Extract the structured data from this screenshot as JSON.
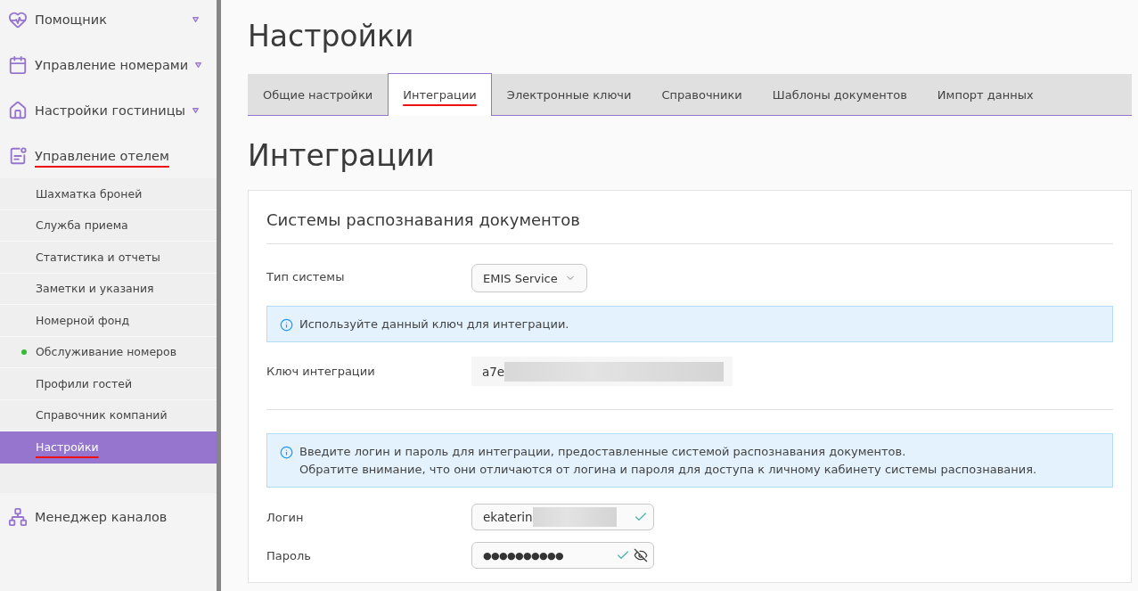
{
  "sidebar": {
    "items": [
      {
        "label": "Помощник",
        "caret": true,
        "marked": false
      },
      {
        "label": "Управление номерами",
        "caret": true,
        "marked": false
      },
      {
        "label": "Настройки гостиницы",
        "caret": true,
        "marked": false
      },
      {
        "label": "Управление отелем",
        "caret": false,
        "marked": true,
        "children": [
          {
            "label": "Шахматка броней",
            "selected": false,
            "marked": false,
            "dot": false
          },
          {
            "label": "Служба приема",
            "selected": false,
            "marked": false,
            "dot": false
          },
          {
            "label": "Статистика и отчеты",
            "selected": false,
            "marked": false,
            "dot": false
          },
          {
            "label": "Заметки и указания",
            "selected": false,
            "marked": false,
            "dot": false
          },
          {
            "label": "Номерной фонд",
            "selected": false,
            "marked": false,
            "dot": false
          },
          {
            "label": "Обслуживание номеров",
            "selected": false,
            "marked": false,
            "dot": true
          },
          {
            "label": "Профили гостей",
            "selected": false,
            "marked": false,
            "dot": false
          },
          {
            "label": "Справочник компаний",
            "selected": false,
            "marked": false,
            "dot": false
          },
          {
            "label": "Настройки",
            "selected": true,
            "marked": true,
            "dot": false
          }
        ]
      },
      {
        "label": "Менеджер каналов",
        "caret": false,
        "marked": false
      }
    ]
  },
  "page_title": "Настройки",
  "tabs": [
    {
      "label": "Общие настройки",
      "selected": false,
      "marked": false
    },
    {
      "label": "Интеграции",
      "selected": true,
      "marked": true
    },
    {
      "label": "Электронные ключи",
      "selected": false,
      "marked": false
    },
    {
      "label": "Справочники",
      "selected": false,
      "marked": false
    },
    {
      "label": "Шаблоны документов",
      "selected": false,
      "marked": false
    },
    {
      "label": "Импорт данных",
      "selected": false,
      "marked": false
    }
  ],
  "section_title": "Интеграции",
  "card": {
    "title": "Системы распознавания документов",
    "system_type": {
      "label": "Тип системы",
      "value": "EMIS Service"
    },
    "key_notice": "Используйте данный ключ для интеграции.",
    "integration_key": {
      "label": "Ключ интеграции",
      "value": "a7e",
      "redacted": true
    },
    "credentials_notice": [
      "Введите логин и пароль для интеграции, предоставленные системой распознавания документов.",
      "Обратите внимание, что они отличаются от логина и пароля для доступа к личному кабинету системы распознавания."
    ],
    "login": {
      "label": "Логин",
      "value": "ekaterin",
      "redacted": true,
      "valid": true
    },
    "password": {
      "label": "Пароль",
      "value": "●●●●●●●●●●",
      "valid": true,
      "visible": false
    }
  }
}
